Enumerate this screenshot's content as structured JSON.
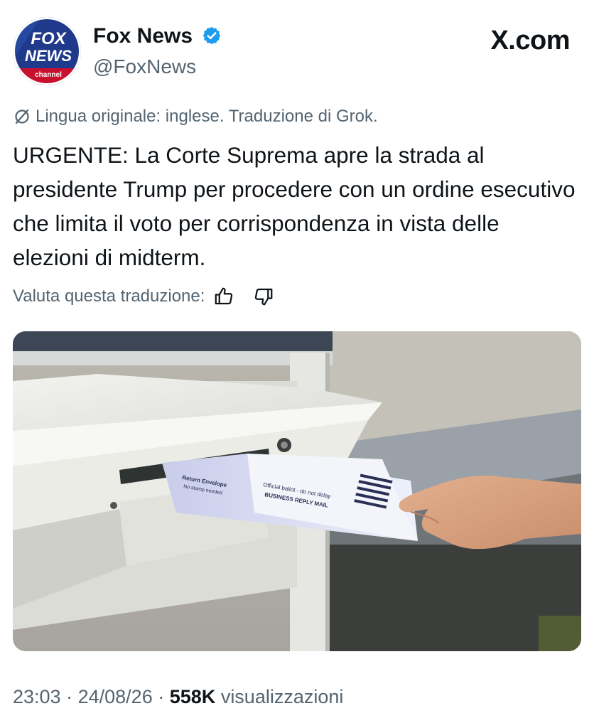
{
  "author": {
    "name": "Fox News",
    "handle": "@FoxNews",
    "avatar_logo": {
      "line1": "FOX",
      "line2": "NEWS",
      "line3": "channel"
    }
  },
  "brand": "X.com",
  "translation_note": "Lingua originale: inglese. Traduzione di Grok.",
  "post_text": "URGENTE: La Corte Suprema apre la strada al presidente Trump per procedere con un ordine esecutivo che limita il voto per corrispondenza in vista delle elezioni di midterm.",
  "rate_translation": "Valuta questa traduzione:",
  "image": {
    "envelope_left": {
      "line1": "Return Envelope",
      "line2": "No stamp needed"
    },
    "envelope_right": {
      "line1": "Official ballot - do not delay",
      "line2": "BUSINESS REPLY MAIL"
    }
  },
  "meta": {
    "time": "23:03",
    "date": "24/08/26",
    "separator": "·",
    "views": "558K",
    "views_label": "visualizzazioni"
  },
  "colors": {
    "verified": "#1d9bf0",
    "secondary_text": "#536471",
    "fox_red": "#c8102e",
    "fox_blue": "#1f3a8a"
  },
  "icons": [
    "verified-badge-icon",
    "translate-icon",
    "thumbs-up-icon",
    "thumbs-down-icon"
  ]
}
